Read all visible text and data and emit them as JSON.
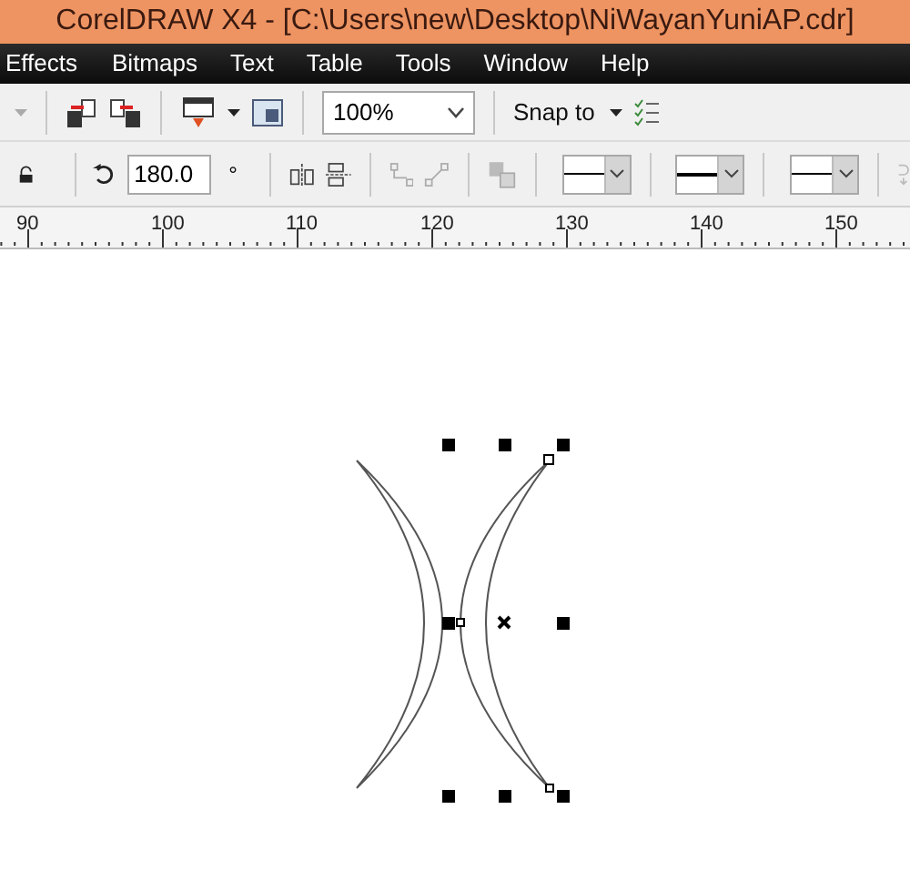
{
  "window": {
    "title": "CorelDRAW X4 - [C:\\Users\\new\\Desktop\\NiWayanYuniAP.cdr]"
  },
  "menu": [
    "Effects",
    "Bitmaps",
    "Text",
    "Table",
    "Tools",
    "Window",
    "Help"
  ],
  "standard_toolbar": {
    "zoom": "100%",
    "snap": "Snap to"
  },
  "property_bar": {
    "rotation": "180.0",
    "degree": "°"
  },
  "ruler": [
    "90",
    "100",
    "110",
    "120",
    "130",
    "140",
    "150"
  ]
}
